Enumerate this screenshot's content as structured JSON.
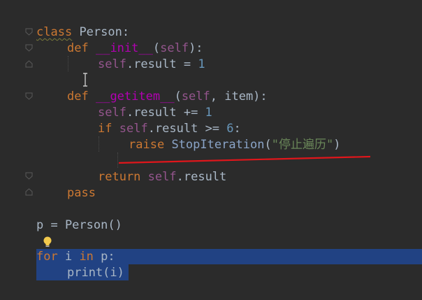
{
  "editor": {
    "lines": {
      "l1": {
        "kw": "class",
        "name": "Person",
        "tail": ":"
      },
      "l2": {
        "kw": "def",
        "name": "__init__",
        "open": "(",
        "self": "self",
        "tail": "):"
      },
      "l3": {
        "self": "self",
        "mid": ".result = ",
        "num": "1"
      },
      "l4": {
        "kw": "def",
        "name": "__getitem__",
        "open": "(",
        "self": "self",
        "tail": ", item):"
      },
      "l5": {
        "self": "self",
        "mid": ".result += ",
        "num": "1"
      },
      "l6": {
        "kw": "if",
        "self": "self",
        "mid": ".result >= ",
        "num": "6",
        "tail": ":"
      },
      "l7": {
        "kw": "raise",
        "name": "StopIteration",
        "open": "(",
        "str": "\"停止遍历\"",
        "tail": ")"
      },
      "l8": {
        "kw": "return",
        "self": "self",
        "tail": ".result"
      },
      "l9": {
        "kw": "pass"
      },
      "l10": {
        "text": "p = Person()"
      },
      "l11": {
        "kw": "for",
        "mid": " i ",
        "kw2": "in",
        "tail": " p:"
      },
      "l12": {
        "text": "print(i)"
      }
    },
    "colors": {
      "background": "#2b2b2b",
      "keyword": "#cc7832",
      "self": "#94558d",
      "number": "#6897bb",
      "magic_method": "#b200b2",
      "string": "#6a8759",
      "text": "#a9b7c6",
      "selection": "#214283",
      "annotation_underline": "#e0161b"
    },
    "icons": {
      "fold": "fold-marker-icon",
      "bulb": "lightbulb-intention-icon",
      "cursor": "text-cursor-icon"
    }
  }
}
